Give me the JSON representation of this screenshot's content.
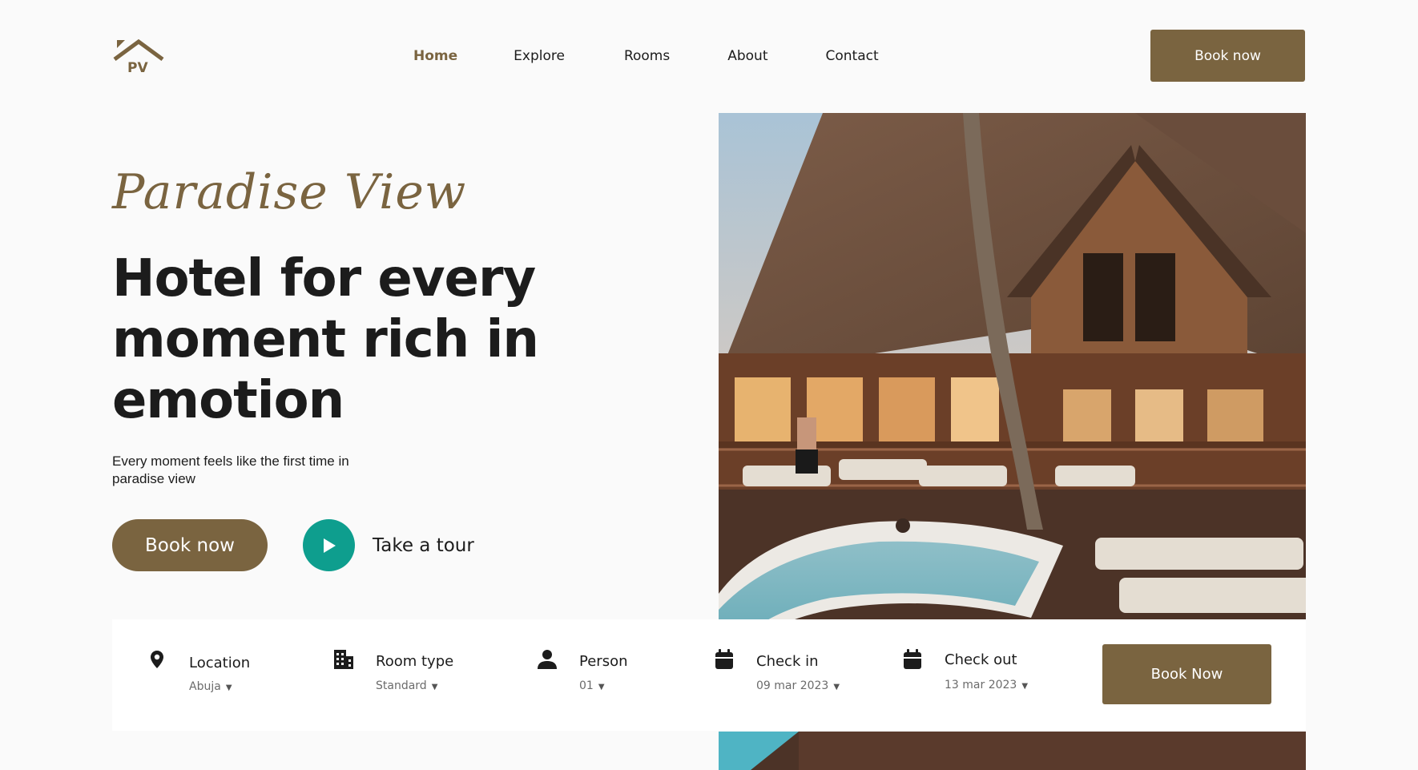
{
  "brand": {
    "logo_text": "PV",
    "accent": "#7a6440",
    "teal": "#0e9e8e"
  },
  "nav": {
    "items": [
      "Home",
      "Explore",
      "Rooms",
      "About",
      "Contact"
    ],
    "active": "Home",
    "book_label": "Book now"
  },
  "hero": {
    "script_title": "Paradise View",
    "headline": "Hotel for every moment rich in emotion",
    "subtitle": "Every moment feels like the first time in paradise view",
    "book_label": "Book now",
    "tour_label": "Take a tour"
  },
  "booking": {
    "fields": [
      {
        "icon": "location-pin-icon",
        "label": "Location",
        "value": "Abuja"
      },
      {
        "icon": "building-icon",
        "label": "Room type",
        "value": "Standard"
      },
      {
        "icon": "person-icon",
        "label": "Person",
        "value": "01"
      },
      {
        "icon": "calendar-icon",
        "label": "Check in",
        "value": "09 mar 2023"
      },
      {
        "icon": "calendar-icon",
        "label": "Check out",
        "value": "13 mar 2023"
      }
    ],
    "button_label": "Book Now"
  }
}
